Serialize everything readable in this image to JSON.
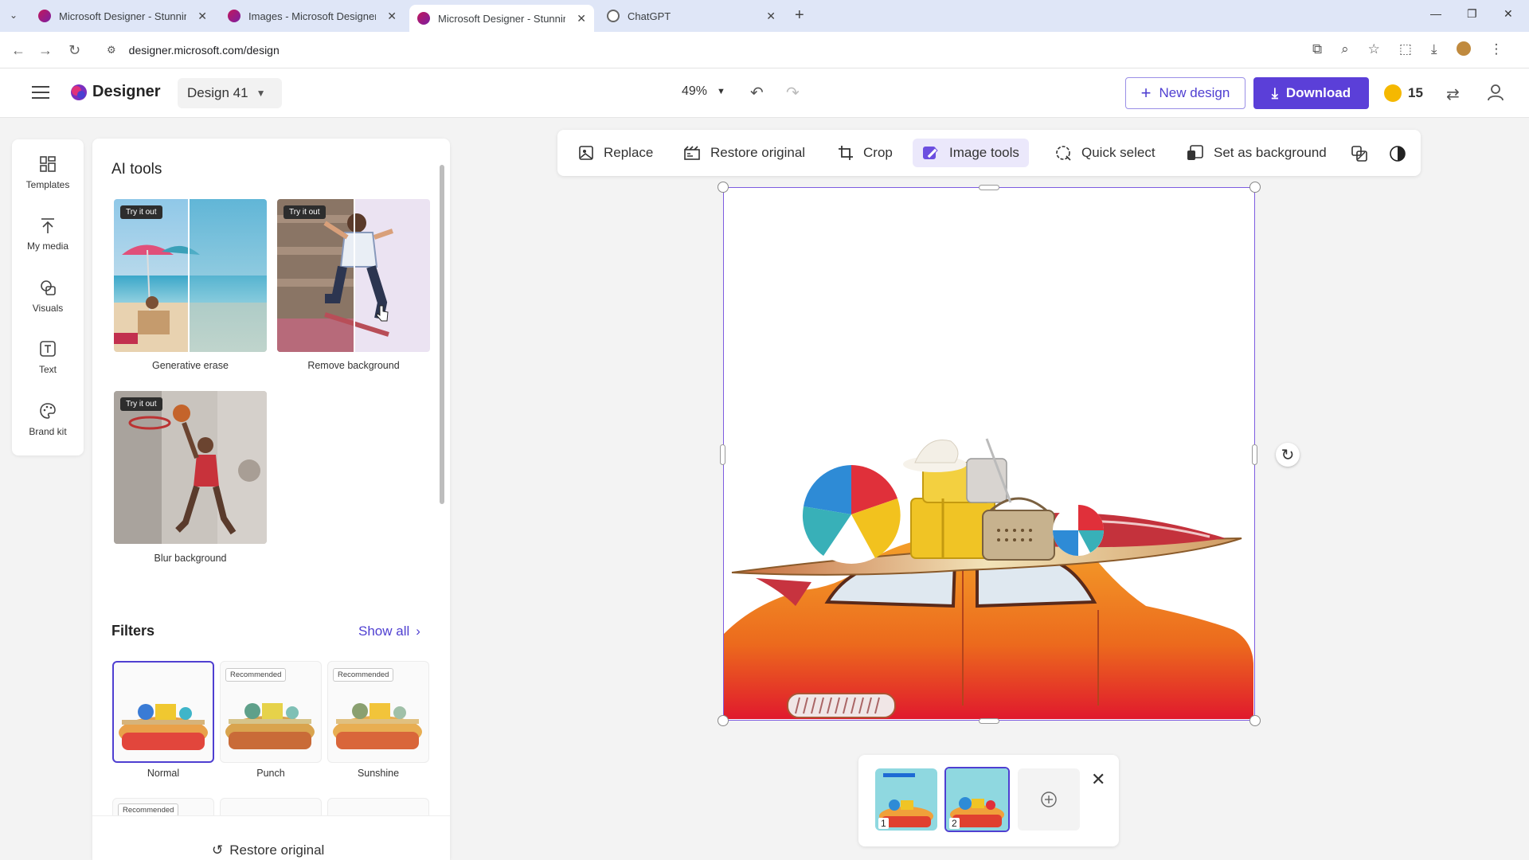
{
  "browser": {
    "tabs": [
      {
        "title": "Microsoft Designer - Stunning d",
        "close": "✕"
      },
      {
        "title": "Images - Microsoft Designer",
        "close": "✕"
      },
      {
        "title": "Microsoft Designer - Stunning d",
        "close": "✕"
      },
      {
        "title": "ChatGPT",
        "close": "✕"
      }
    ],
    "new_tab": "+",
    "url": "designer.microsoft.com/design",
    "window_controls": [
      "—",
      "❐",
      "✕"
    ]
  },
  "header": {
    "app_name": "Designer",
    "design_name": "Design 41",
    "zoom": "49%",
    "new_design": "New design",
    "download": "Download",
    "coins": "15"
  },
  "rail": [
    {
      "label": "Templates",
      "icon": "templates-icon"
    },
    {
      "label": "My media",
      "icon": "upload-icon"
    },
    {
      "label": "Visuals",
      "icon": "visuals-icon"
    },
    {
      "label": "Text",
      "icon": "text-icon"
    },
    {
      "label": "Brand kit",
      "icon": "palette-icon"
    }
  ],
  "ai_tools": {
    "title": "AI tools",
    "try_tag": "Try it out",
    "items": [
      {
        "label": "Generative erase"
      },
      {
        "label": "Remove background"
      },
      {
        "label": "Blur background"
      }
    ]
  },
  "filters": {
    "title": "Filters",
    "show_all": "Show all",
    "recommended_tag": "Recommended",
    "items": [
      {
        "label": "Normal"
      },
      {
        "label": "Punch"
      },
      {
        "label": "Sunshine"
      }
    ],
    "restore": "Restore original"
  },
  "toolbar": {
    "replace": "Replace",
    "restore_original": "Restore original",
    "crop": "Crop",
    "image_tools": "Image tools",
    "quick_select": "Quick select",
    "set_as_background": "Set as background"
  },
  "pages": {
    "items": [
      "1",
      "2"
    ]
  },
  "colors": {
    "accent": "#5b3fd8",
    "selection": "#7d5ce0"
  }
}
